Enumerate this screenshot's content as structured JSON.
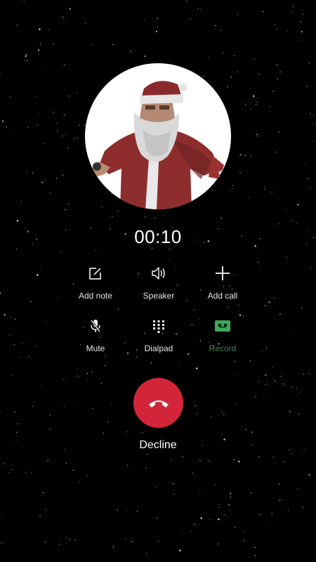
{
  "call": {
    "timer": "00:10"
  },
  "actions": [
    {
      "label": "Add note",
      "icon": "add-note-icon"
    },
    {
      "label": "Speaker",
      "icon": "speaker-icon"
    },
    {
      "label": "Add call",
      "icon": "add-call-icon"
    },
    {
      "label": "Mute",
      "icon": "mute-icon"
    },
    {
      "label": "Dialpad",
      "icon": "dialpad-icon"
    },
    {
      "label": "Record",
      "icon": "record-icon"
    }
  ],
  "decline": {
    "label": "Decline",
    "icon": "hang-up-icon",
    "color": "#d3253a"
  },
  "colors": {
    "background": "#000000",
    "record_accent": "#3fa85a"
  }
}
